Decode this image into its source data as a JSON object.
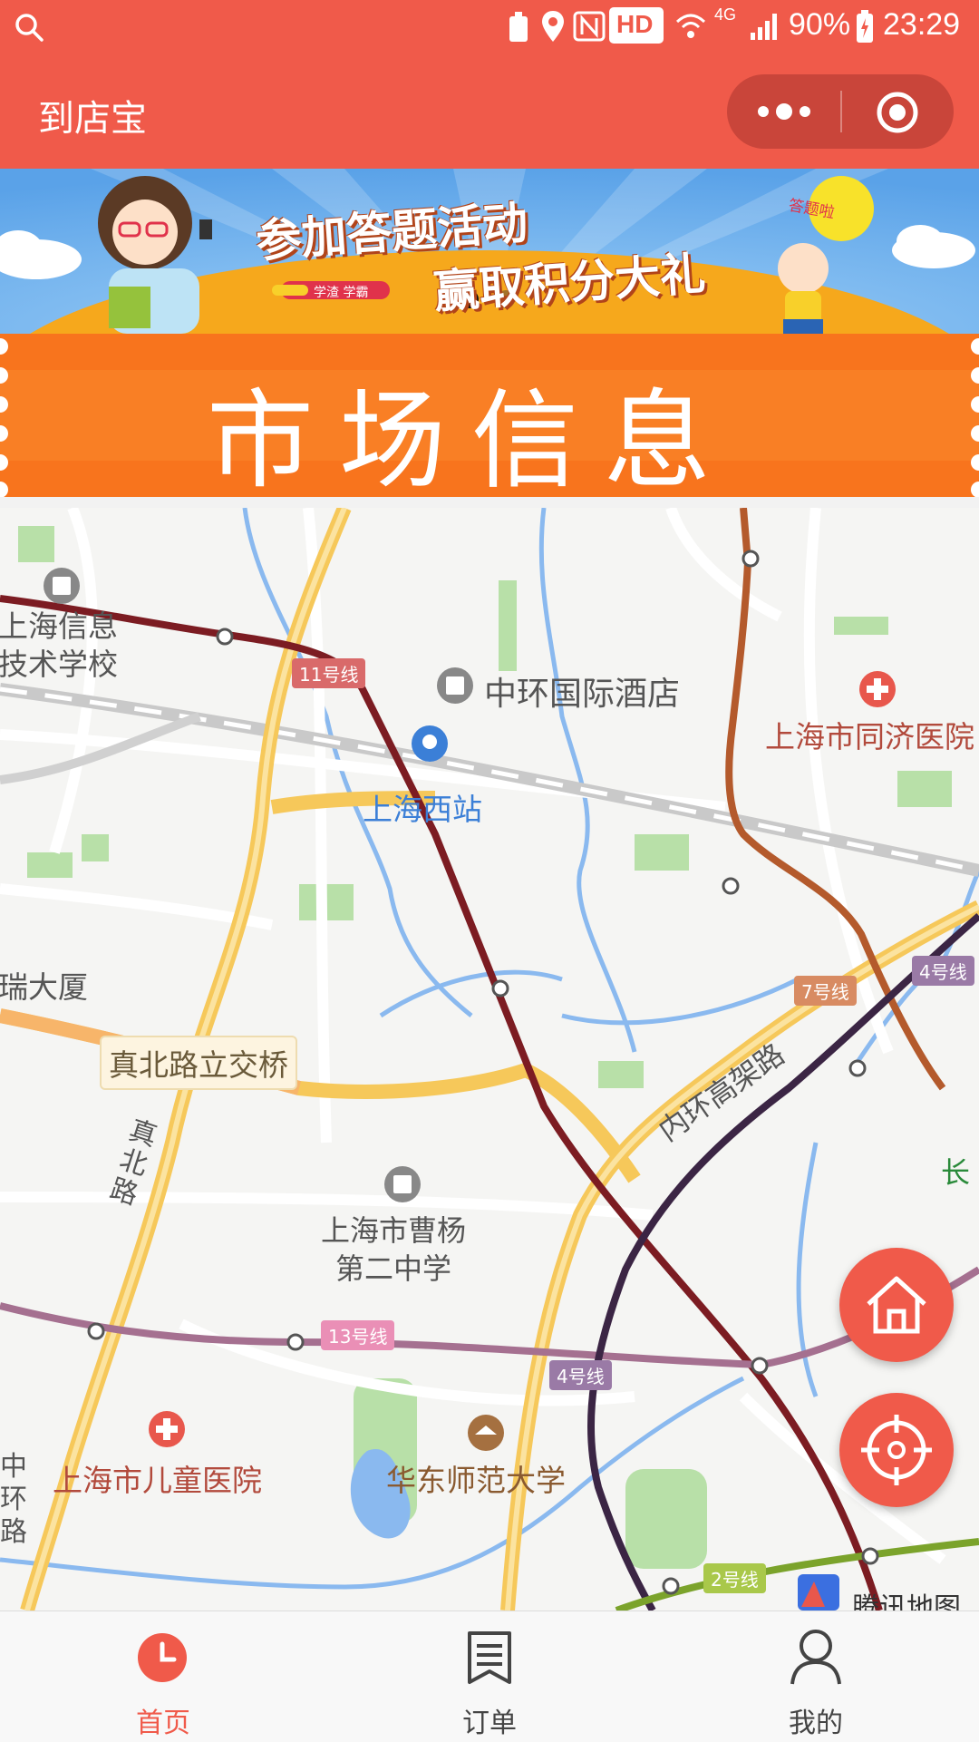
{
  "status_bar": {
    "battery": "90%",
    "time": "23:29",
    "hd": "HD",
    "network": "4G"
  },
  "header": {
    "title": "到店宝"
  },
  "banner": {
    "headline_1": "参加答题活动",
    "headline_2": "赢取积分大礼",
    "tag": "学渣 学霸",
    "bubble": "答题啦"
  },
  "market": {
    "title": "市场信息"
  },
  "map": {
    "places": {
      "school_info": "上海信息\n技术学校",
      "hotel": "中环国际酒店",
      "hospital_tongji": "上海市同济医院",
      "station": "上海西站",
      "building": "瑞大厦",
      "bridge": "真北路立交桥",
      "road_zhenbei": "真\n北\n路",
      "elevated": "内环高架路",
      "school_caoyang": "上海市曹杨\n第二中学",
      "hospital_children": "上海市儿童医院",
      "university": "华东师范大学",
      "zhonghuan": "中\n环\n路",
      "chang": "长",
      "provider": "腾讯地图"
    },
    "lines": {
      "l11": "11号线",
      "l7": "7号线",
      "l4a": "4号线",
      "l4b": "4号线",
      "l13": "13号线",
      "l2": "2号线"
    }
  },
  "nav": {
    "items": [
      {
        "label": "首页",
        "icon": "clock-icon",
        "active": true
      },
      {
        "label": "订单",
        "icon": "document-icon",
        "active": false
      },
      {
        "label": "我的",
        "icon": "user-icon",
        "active": false
      }
    ]
  },
  "colors": {
    "brand": "#f05a4a",
    "market": "#f8741d",
    "active_nav": "#f05a4a",
    "inactive_nav": "#444444"
  }
}
